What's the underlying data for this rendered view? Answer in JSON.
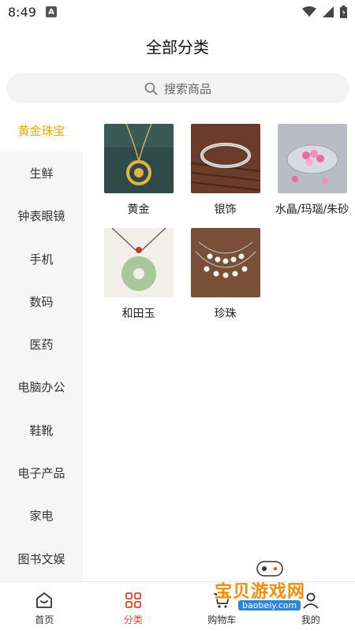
{
  "status_bar": {
    "time": "8:49",
    "notification_badge": "A"
  },
  "header": {
    "title": "全部分类"
  },
  "search": {
    "placeholder": "搜索商品"
  },
  "sidebar": {
    "items": [
      {
        "label": "黄金珠宝",
        "active": true
      },
      {
        "label": "生鲜"
      },
      {
        "label": "钟表眼镜"
      },
      {
        "label": "手机"
      },
      {
        "label": "数码"
      },
      {
        "label": "医药"
      },
      {
        "label": "电脑办公"
      },
      {
        "label": "鞋靴"
      },
      {
        "label": "电子产品"
      },
      {
        "label": "家电"
      },
      {
        "label": "图书文娱"
      }
    ]
  },
  "categories": [
    {
      "label": "黄金",
      "image": "gold-pendant-image"
    },
    {
      "label": "银饰",
      "image": "silver-bracelet-image"
    },
    {
      "label": "水晶/玛瑙/朱砂",
      "image": "crystal-image"
    },
    {
      "label": "和田玉",
      "image": "jade-pendant-image"
    },
    {
      "label": "珍珠",
      "image": "pearl-necklace-image"
    }
  ],
  "bottom_nav": {
    "items": [
      {
        "label": "首页",
        "icon": "home-icon"
      },
      {
        "label": "分类",
        "icon": "category-icon",
        "active": true
      },
      {
        "label": "购物车",
        "icon": "cart-icon"
      },
      {
        "label": "我的",
        "icon": "profile-icon"
      }
    ]
  },
  "watermark": {
    "title": "宝贝游戏网",
    "url": "baobeiy.com"
  },
  "colors": {
    "active_sidebar": "#f0a800",
    "active_nav": "#e8432a",
    "sidebar_bg": "#f6f6f6"
  }
}
